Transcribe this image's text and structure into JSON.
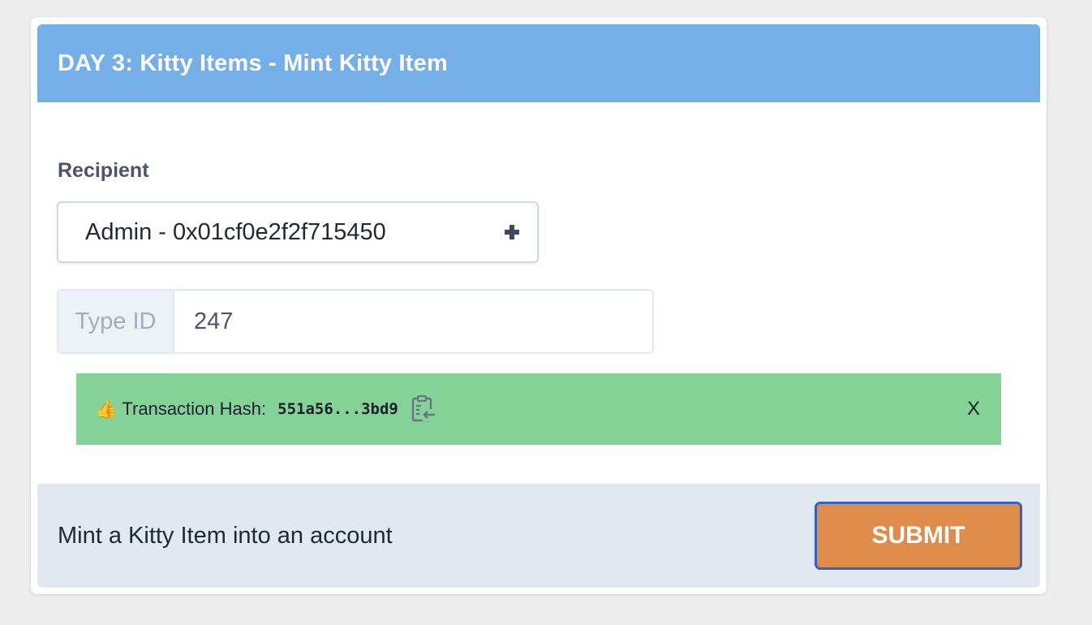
{
  "header": {
    "title": "DAY 3: Kitty Items - Mint Kitty Item"
  },
  "form": {
    "recipient_label": "Recipient",
    "recipient_value": "Admin - 0x01cf0e2f2f715450",
    "type_id_label": "Type ID",
    "type_id_value": "247"
  },
  "toast": {
    "emoji": "👍",
    "label": "Transaction Hash:",
    "hash": "551a56...3bd9",
    "close_label": "X"
  },
  "footer": {
    "description": "Mint a Kitty Item into an account",
    "submit_label": "SUBMIT"
  },
  "colors": {
    "header_bg": "#74b0e7",
    "toast_bg": "#84d297",
    "submit_bg": "#df8c4a",
    "submit_border": "#2f63c4",
    "footer_bg": "#e2e8f0"
  }
}
